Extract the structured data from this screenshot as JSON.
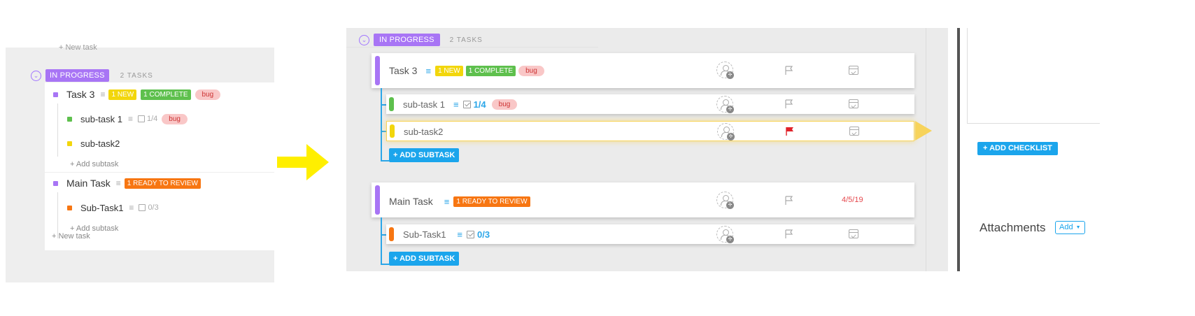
{
  "left": {
    "cut_text": "+ New task",
    "group": {
      "status": "IN PROGRESS",
      "count": "2 TASKS"
    },
    "tasks": [
      {
        "name": "Task 3",
        "color": "#a875f5",
        "tags": [
          "1 NEW",
          "1 COMPLETE"
        ],
        "label": "bug"
      },
      {
        "name": "sub-task 1",
        "color": "#5ec04d",
        "checklist": "1/4",
        "label": "bug"
      },
      {
        "name": "sub-task2",
        "color": "#f2d60c"
      },
      {
        "name": "Main Task",
        "color": "#a875f5",
        "tags": [
          "1 READY TO REVIEW"
        ]
      },
      {
        "name": "Sub-Task1",
        "color": "#f77612",
        "checklist": "0/3"
      }
    ],
    "add_subtask": "+ Add subtask",
    "new_task": "+ New task"
  },
  "middle": {
    "group": {
      "status": "IN PROGRESS",
      "count": "2 TASKS"
    },
    "task3": {
      "name": "Task 3",
      "tags": [
        "1 NEW",
        "1 COMPLETE"
      ],
      "label": "bug"
    },
    "subtask1": {
      "name": "sub-task 1",
      "checklist": "1/4",
      "label": "bug"
    },
    "subtask2": {
      "name": "sub-task2"
    },
    "main_task": {
      "name": "Main Task",
      "tag": "1 READY TO REVIEW",
      "due": "4/5/19"
    },
    "subtask_main": {
      "name": "Sub-Task1",
      "checklist": "0/3"
    },
    "add_subtask": "+ ADD SUBTASK"
  },
  "right": {
    "add_checklist": "+ ADD CHECKLIST",
    "attachments": "Attachments",
    "add": "Add"
  },
  "colors": {
    "purple": "#a875f5",
    "green": "#5ec04d",
    "yellow": "#f2d60c",
    "orange": "#f77612",
    "blue": "#1ba5ec",
    "flag_red": "#e0222a"
  }
}
